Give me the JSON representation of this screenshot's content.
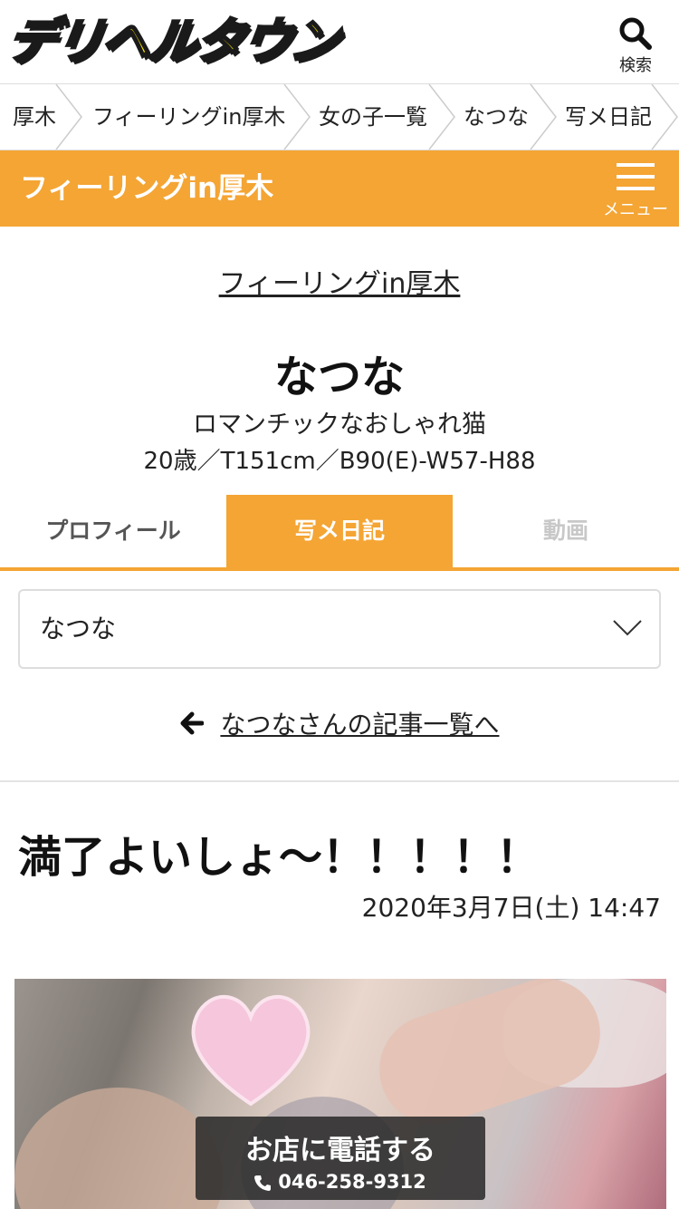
{
  "header": {
    "logo_text": "デリヘルタウン",
    "search_label": "検索"
  },
  "breadcrumb": [
    "厚木",
    "フィーリングin厚木",
    "女の子一覧",
    "なつな",
    "写メ日記"
  ],
  "shop_bar": {
    "title": "フィーリングin厚木",
    "menu_label": "メニュー"
  },
  "profile": {
    "shop_link": "フィーリングin厚木",
    "name": "なつな",
    "catch": "ロマンチックなおしゃれ猫",
    "spec": "20歳／T151cm／B90(E)-W57-H88"
  },
  "tabs": {
    "profile": "プロフィール",
    "diary": "写メ日記",
    "movie": "動画"
  },
  "girl_select": {
    "value": "なつな"
  },
  "back_link": "なつなさんの記事一覧へ",
  "post": {
    "title": "満了よいしょ〜！！！！！",
    "date": "2020年3月7日(土) 14:47"
  },
  "call": {
    "label": "お店に電話する",
    "tel": "046-258-9312"
  },
  "colors": {
    "accent": "#f4a534",
    "logo_yellow": "#ffe600"
  }
}
